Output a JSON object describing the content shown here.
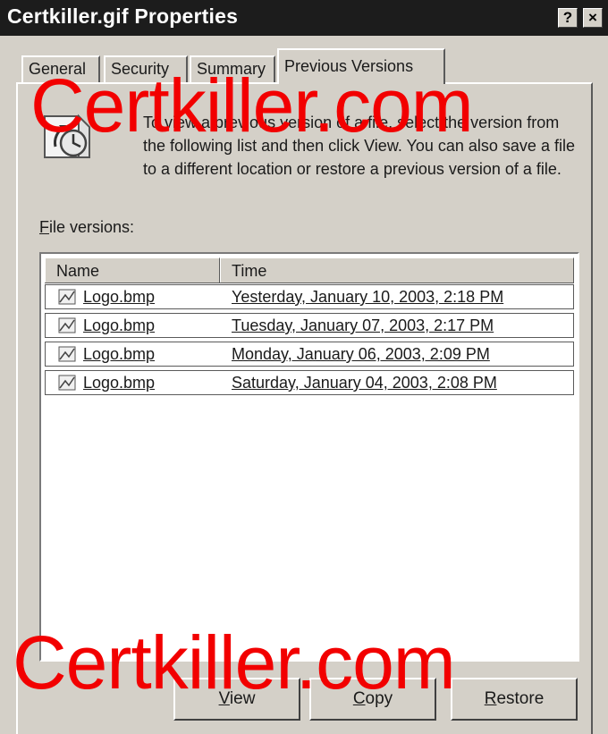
{
  "window": {
    "title": "Certkiller.gif Properties",
    "help_glyph": "?",
    "close_glyph": "×"
  },
  "tabs": [
    {
      "label": "General"
    },
    {
      "label": "Security"
    },
    {
      "label": "Summary"
    },
    {
      "label": "Previous Versions",
      "selected": true
    }
  ],
  "intro": {
    "icon": "previous-versions-icon",
    "text": "To view a previous version of a file, select the version from the following list and then click View. You can also save a file to a different location or restore a previous version of a file."
  },
  "file_versions": {
    "label_prefix": "",
    "label_accel": "F",
    "label_rest": "ile versions:",
    "columns": [
      "Name",
      "Time"
    ],
    "rows": [
      {
        "name": "Logo.bmp",
        "time": "Yesterday, January 10, 2003, 2:18 PM",
        "icon": "bitmap-file-icon"
      },
      {
        "name": "Logo.bmp",
        "time": "Tuesday, January 07, 2003, 2:17 PM",
        "icon": "bitmap-file-icon"
      },
      {
        "name": "Logo.bmp",
        "time": "Monday, January 06, 2003, 2:09 PM",
        "icon": "bitmap-file-icon"
      },
      {
        "name": "Logo.bmp",
        "time": "Saturday, January 04, 2003, 2:08 PM",
        "icon": "bitmap-file-icon"
      }
    ]
  },
  "buttons": {
    "view": {
      "accel": "V",
      "rest": "iew"
    },
    "copy": {
      "accel": "C",
      "rest": "opy"
    },
    "restore": {
      "accel": "R",
      "rest": "estore"
    }
  },
  "watermark": {
    "text": "Certkiller.com",
    "color": "#f20000"
  }
}
